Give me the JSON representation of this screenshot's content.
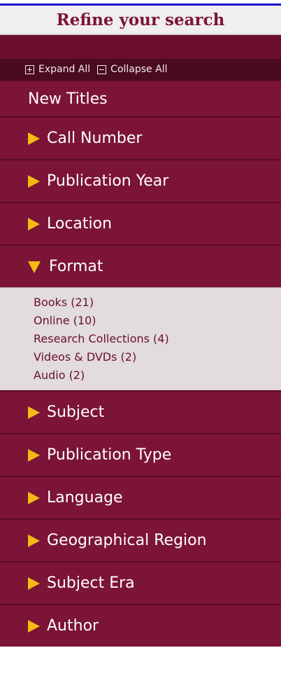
{
  "header": {
    "title": "Refine your search"
  },
  "toolbar": {
    "expand_label": "Expand All",
    "collapse_label": "Collapse All"
  },
  "facets": [
    {
      "label": "New Titles"
    },
    {
      "label": "Call Number"
    },
    {
      "label": "Publication Year"
    },
    {
      "label": "Location"
    },
    {
      "label": "Format"
    },
    {
      "label": "Subject"
    },
    {
      "label": "Publication Type"
    },
    {
      "label": "Language"
    },
    {
      "label": "Geographical Region"
    },
    {
      "label": "Subject Era"
    },
    {
      "label": "Author"
    }
  ],
  "format_options": [
    "Books (21)",
    "Online (10)",
    "Research Collections (4)",
    "Videos & DVDs (2)",
    "Audio (2)"
  ],
  "colors": {
    "panel": "#7b1436",
    "arrow": "#f3ba13",
    "toolbar": "#4a0a1f",
    "expanded_bg": "#e2dcdc"
  }
}
